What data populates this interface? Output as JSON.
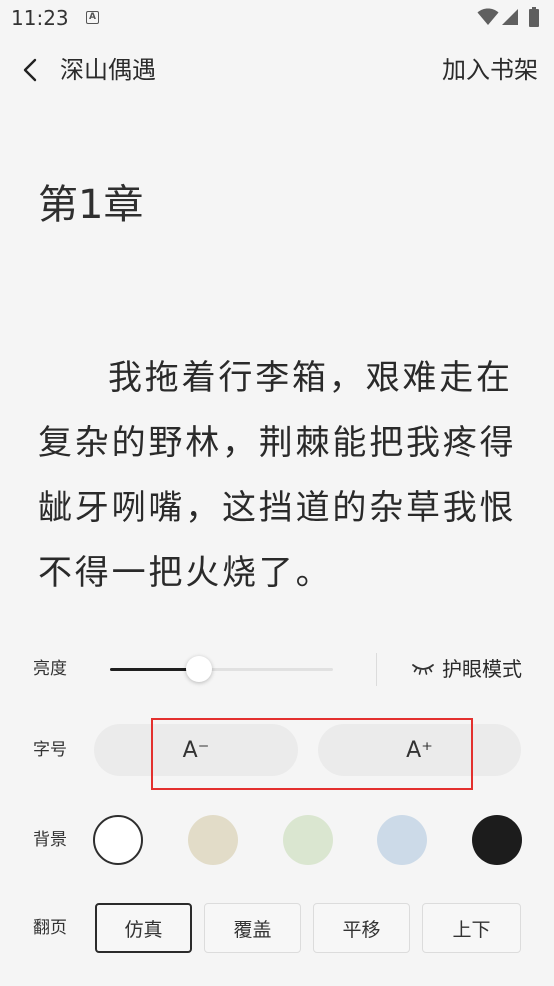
{
  "status_bar": {
    "time": "11:23",
    "notification_glyph": "A",
    "icons": [
      "app-notification-icon",
      "wifi-icon",
      "signal-icon",
      "battery-icon"
    ]
  },
  "header": {
    "back_icon": "chevron-left-icon",
    "title": "深山偶遇",
    "add_to_shelf": "加入书架"
  },
  "chapter": {
    "title": "第1章",
    "paragraph": "我拖着行李箱，艰难走在复杂的野林，荆棘能把我疼得龇牙咧嘴，这挡道的杂草我恨不得一把火烧了。"
  },
  "settings": {
    "brightness": {
      "label": "亮度",
      "value": 0.4,
      "eye_care_icon": "closed-eye-icon",
      "eye_care_label": "护眼模式"
    },
    "font_size": {
      "label": "字号",
      "decrease": "A⁻",
      "increase": "A⁺"
    },
    "background": {
      "label": "背景",
      "colors": [
        "#ffffff",
        "#e2dcc8",
        "#dae6d0",
        "#ccdae8",
        "#1c1c1c"
      ],
      "selected": 0
    },
    "page_turn": {
      "label": "翻页",
      "options": [
        "仿真",
        "覆盖",
        "平移",
        "上下"
      ],
      "selected": 0
    }
  },
  "colors": {
    "page_background": "#f5f5f5",
    "text": "#2b2b2b",
    "pill": "#ebebeb",
    "slider_fill": "#1f1f1f",
    "highlight_box": "#e3302e"
  }
}
